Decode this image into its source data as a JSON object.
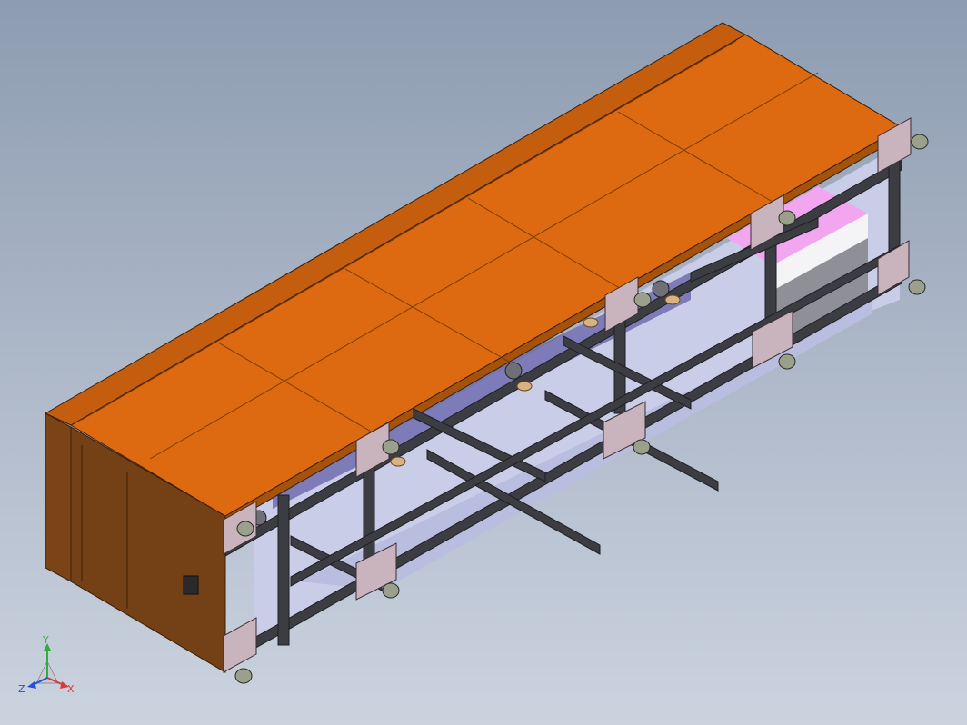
{
  "viewport": {
    "background_top": "#8d9cb1",
    "background_bottom": "#cbd3df"
  },
  "model": {
    "panel_color": "#dd6a10",
    "panel_side_color": "#7a4416",
    "frame_color": "#3b3d42",
    "bracket_color": "#c9b3bd",
    "foot_color": "#9aa08c",
    "accent_pink": "#f2a6f0"
  },
  "triad": {
    "x_label": "X",
    "y_label": "Y",
    "z_label": "Z",
    "x_color": "#d83a3a",
    "y_color": "#2fae3a",
    "z_color": "#2a4ed8"
  }
}
